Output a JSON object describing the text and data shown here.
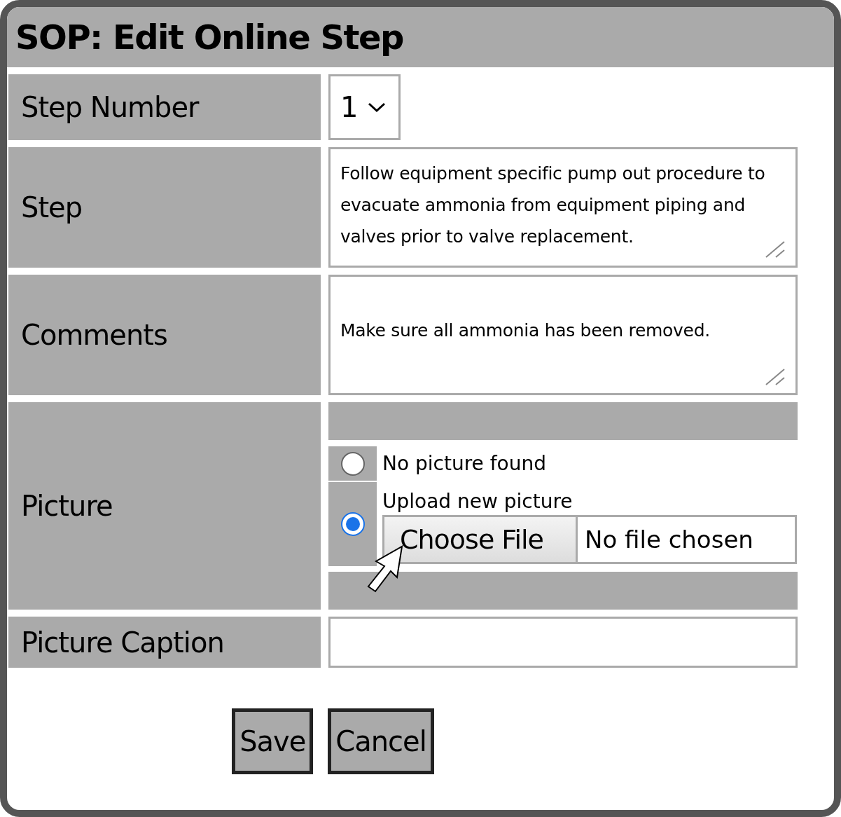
{
  "window": {
    "title": "SOP: Edit Online Step"
  },
  "step_number": {
    "label": "Step Number",
    "value": "1"
  },
  "step": {
    "label": "Step",
    "value": "Follow equipment specific pump out procedure to evacuate ammonia from equipment piping and valves prior to valve replacement."
  },
  "comments": {
    "label": "Comments",
    "value": "Make sure all ammonia has been removed."
  },
  "picture": {
    "label": "Picture",
    "options": [
      {
        "label": "No picture found",
        "selected": false
      },
      {
        "label": "Upload new picture",
        "selected": true
      }
    ],
    "file_button": "Choose File",
    "file_status": "No file chosen"
  },
  "picture_caption": {
    "label": "Picture Caption"
  },
  "buttons": [
    "Save",
    "Cancel"
  ]
}
